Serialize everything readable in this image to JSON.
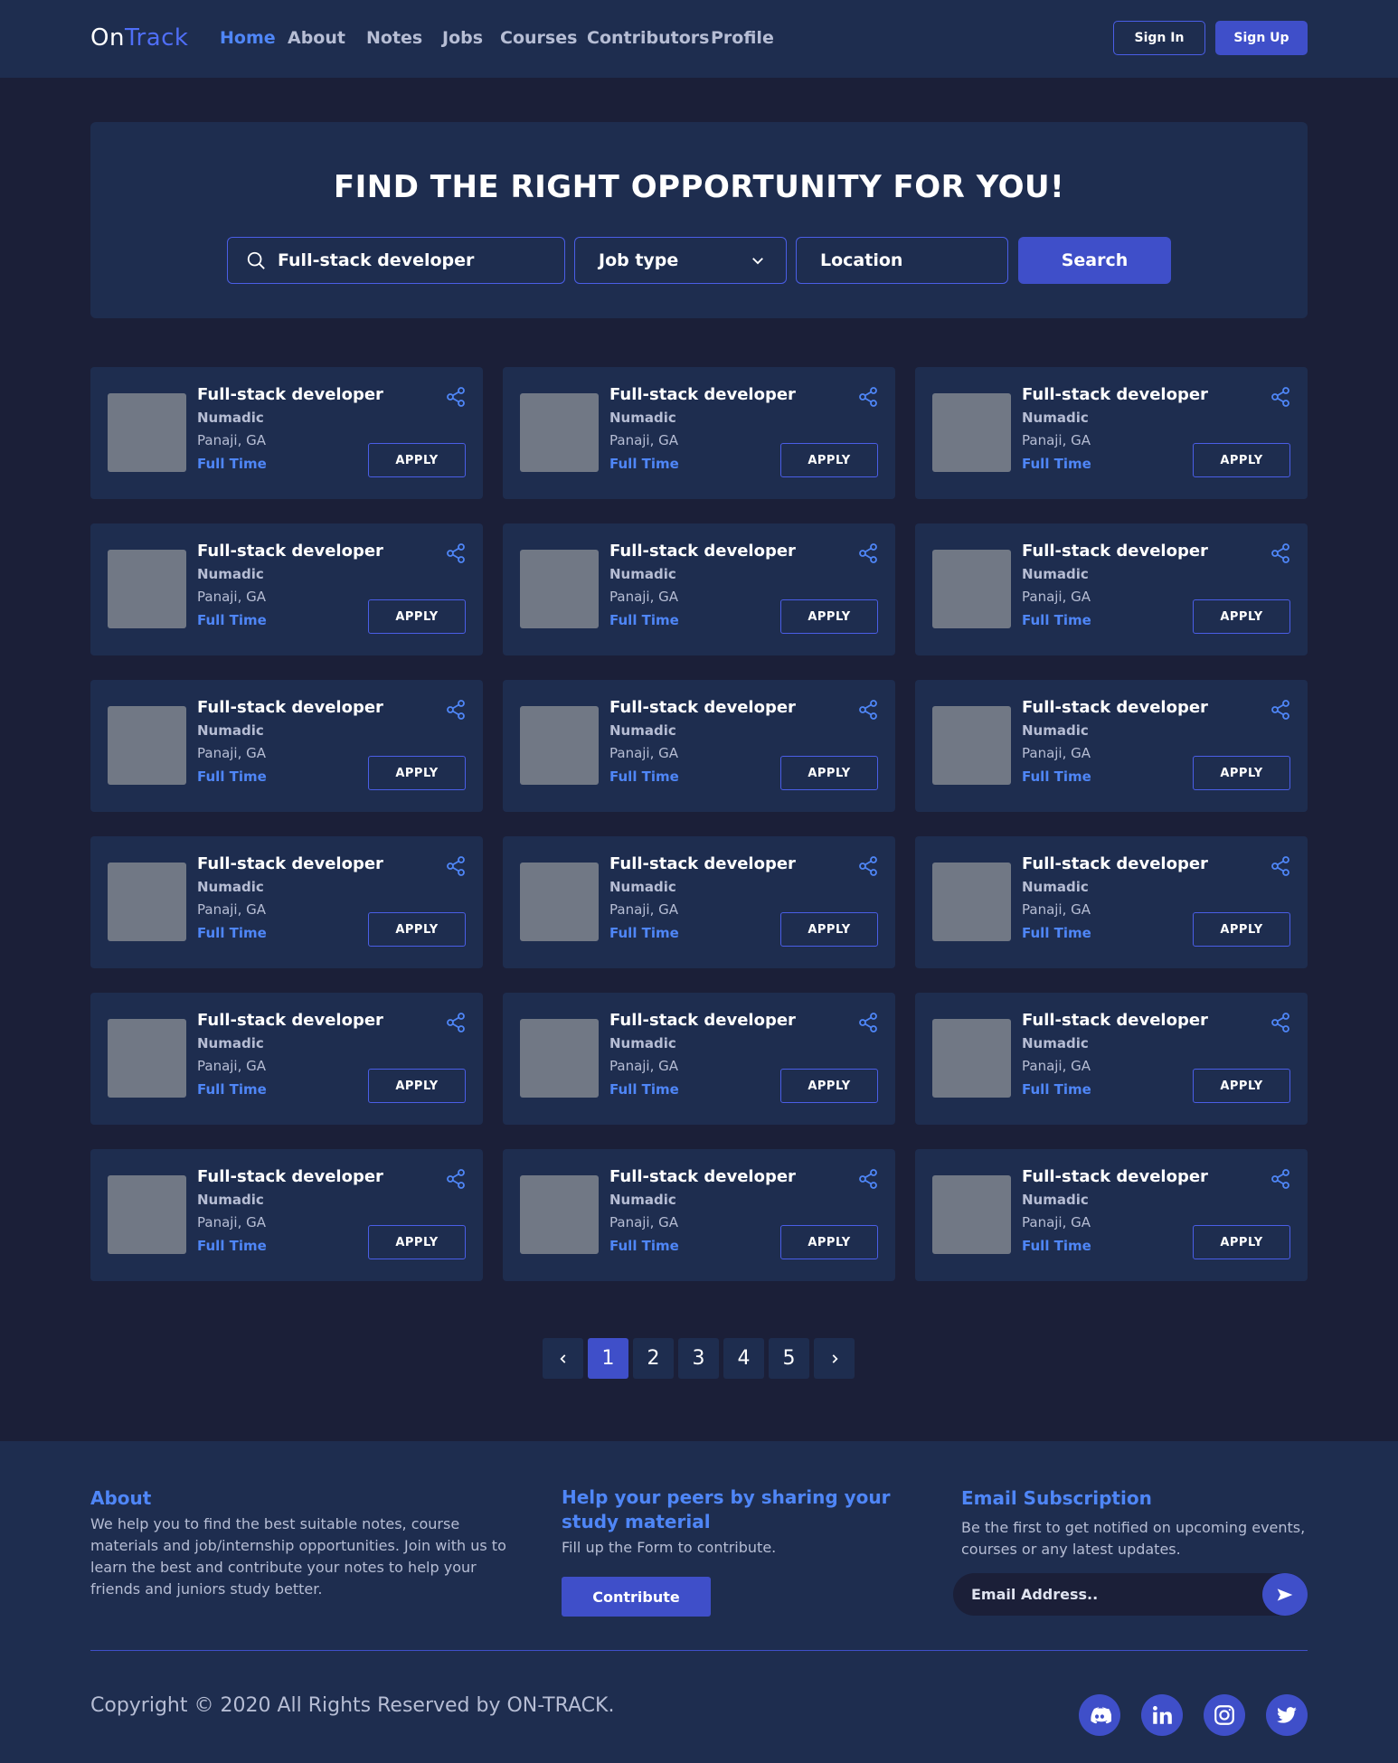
{
  "nav": {
    "logo_on": "On",
    "logo_track": "Track",
    "links": [
      "Home",
      "About",
      "Notes",
      "Jobs",
      "Courses",
      "Contributors",
      "Profile"
    ],
    "signin": "Sign In",
    "signup": "Sign Up"
  },
  "hero": {
    "title": "FIND THE RIGHT OPPORTUNITY FOR YOU!",
    "search_value": "Full-stack developer",
    "job_type": "Job type",
    "location": "Location",
    "search_button": "Search"
  },
  "jobs": [
    {
      "title": "Full-stack developer",
      "company": "Numadic",
      "location": "Panaji, GA",
      "type": "Full Time",
      "apply": "APPLY"
    },
    {
      "title": "Full-stack developer",
      "company": "Numadic",
      "location": "Panaji, GA",
      "type": "Full Time",
      "apply": "APPLY"
    },
    {
      "title": "Full-stack developer",
      "company": "Numadic",
      "location": "Panaji, GA",
      "type": "Full Time",
      "apply": "APPLY"
    },
    {
      "title": "Full-stack developer",
      "company": "Numadic",
      "location": "Panaji, GA",
      "type": "Full Time",
      "apply": "APPLY"
    },
    {
      "title": "Full-stack developer",
      "company": "Numadic",
      "location": "Panaji, GA",
      "type": "Full Time",
      "apply": "APPLY"
    },
    {
      "title": "Full-stack developer",
      "company": "Numadic",
      "location": "Panaji, GA",
      "type": "Full Time",
      "apply": "APPLY"
    },
    {
      "title": "Full-stack developer",
      "company": "Numadic",
      "location": "Panaji, GA",
      "type": "Full Time",
      "apply": "APPLY"
    },
    {
      "title": "Full-stack developer",
      "company": "Numadic",
      "location": "Panaji, GA",
      "type": "Full Time",
      "apply": "APPLY"
    },
    {
      "title": "Full-stack developer",
      "company": "Numadic",
      "location": "Panaji, GA",
      "type": "Full Time",
      "apply": "APPLY"
    },
    {
      "title": "Full-stack developer",
      "company": "Numadic",
      "location": "Panaji, GA",
      "type": "Full Time",
      "apply": "APPLY"
    },
    {
      "title": "Full-stack developer",
      "company": "Numadic",
      "location": "Panaji, GA",
      "type": "Full Time",
      "apply": "APPLY"
    },
    {
      "title": "Full-stack developer",
      "company": "Numadic",
      "location": "Panaji, GA",
      "type": "Full Time",
      "apply": "APPLY"
    },
    {
      "title": "Full-stack developer",
      "company": "Numadic",
      "location": "Panaji, GA",
      "type": "Full Time",
      "apply": "APPLY"
    },
    {
      "title": "Full-stack developer",
      "company": "Numadic",
      "location": "Panaji, GA",
      "type": "Full Time",
      "apply": "APPLY"
    },
    {
      "title": "Full-stack developer",
      "company": "Numadic",
      "location": "Panaji, GA",
      "type": "Full Time",
      "apply": "APPLY"
    },
    {
      "title": "Full-stack developer",
      "company": "Numadic",
      "location": "Panaji, GA",
      "type": "Full Time",
      "apply": "APPLY"
    },
    {
      "title": "Full-stack developer",
      "company": "Numadic",
      "location": "Panaji, GA",
      "type": "Full Time",
      "apply": "APPLY"
    },
    {
      "title": "Full-stack developer",
      "company": "Numadic",
      "location": "Panaji, GA",
      "type": "Full Time",
      "apply": "APPLY"
    }
  ],
  "pagination": {
    "pages": [
      "1",
      "2",
      "3",
      "4",
      "5"
    ],
    "current": "1"
  },
  "footer": {
    "about_title": "About",
    "about_text": "We help you to find the best suitable notes, course materials and job/internship opportunities. Join with us to learn the best and contribute your notes to help your friends and juniors study better.",
    "help_title": "Help your peers by sharing your study material",
    "help_text": "Fill up the Form to contribute.",
    "contribute_button": "Contribute",
    "email_title": "Email Subscription",
    "email_text": "Be the first to get notified on upcoming events, courses or any latest updates.",
    "email_placeholder": "Email Address..",
    "copyright": "Copyright © 2020 All Rights Reserved by ON-TRACK.",
    "social": [
      "discord-icon",
      "linkedin-icon",
      "instagram-icon",
      "twitter-icon"
    ]
  },
  "colors": {
    "background": "#1b1f38",
    "panel": "#1e2d4f",
    "accent": "#3f4fc9",
    "link_blue": "#4f86f7",
    "thumb_gray": "#717885"
  }
}
